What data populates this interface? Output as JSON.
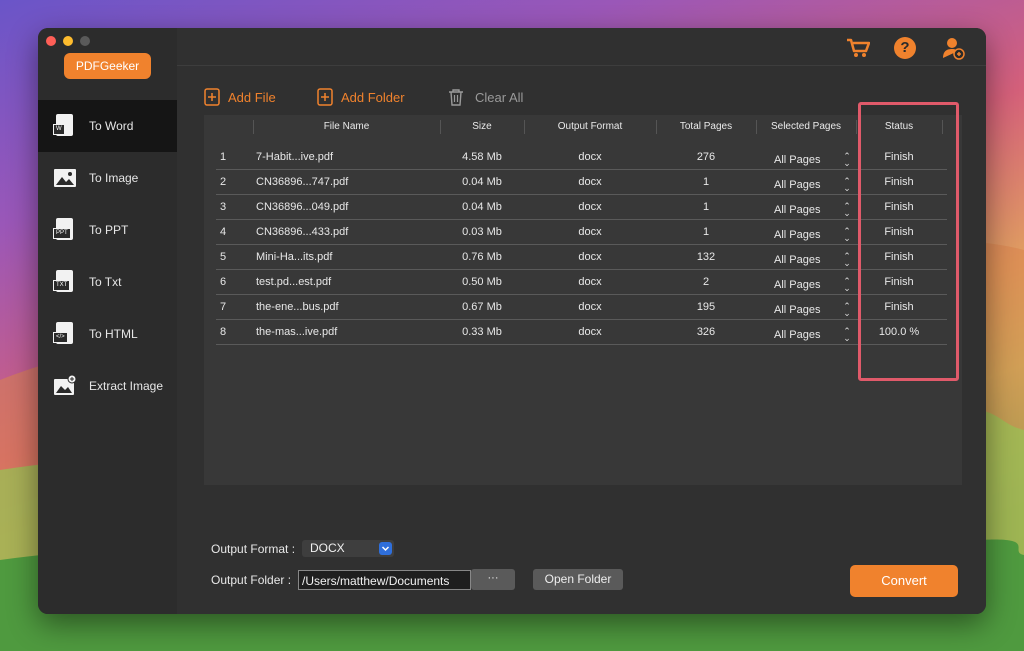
{
  "app": {
    "logo_label": "PDFGeeker"
  },
  "sidebar": {
    "items": [
      {
        "label": "To Word",
        "icon": "word-doc-icon",
        "tag": "W"
      },
      {
        "label": "To Image",
        "icon": "image-icon",
        "tag": ""
      },
      {
        "label": "To PPT",
        "icon": "ppt-doc-icon",
        "tag": "PPT"
      },
      {
        "label": "To Txt",
        "icon": "txt-doc-icon",
        "tag": "TXT"
      },
      {
        "label": "To HTML",
        "icon": "html-doc-icon",
        "tag": "</>"
      },
      {
        "label": "Extract Image",
        "icon": "extract-image-icon",
        "tag": ""
      }
    ]
  },
  "toolbar": {
    "add_file": "Add File",
    "add_folder": "Add Folder",
    "clear_all": "Clear All"
  },
  "table": {
    "headers": [
      "File Name",
      "Size",
      "Output Format",
      "Total Pages",
      "Selected Pages",
      "Status"
    ],
    "rows": [
      {
        "num": "1",
        "name": "7-Habit...ive.pdf",
        "size": "4.58 Mb",
        "format": "docx",
        "pages": "276",
        "selected": "All Pages",
        "status": "Finish"
      },
      {
        "num": "2",
        "name": "CN36896...747.pdf",
        "size": "0.04 Mb",
        "format": "docx",
        "pages": "1",
        "selected": "All Pages",
        "status": "Finish"
      },
      {
        "num": "3",
        "name": "CN36896...049.pdf",
        "size": "0.04 Mb",
        "format": "docx",
        "pages": "1",
        "selected": "All Pages",
        "status": "Finish"
      },
      {
        "num": "4",
        "name": "CN36896...433.pdf",
        "size": "0.03 Mb",
        "format": "docx",
        "pages": "1",
        "selected": "All Pages",
        "status": "Finish"
      },
      {
        "num": "5",
        "name": "Mini-Ha...its.pdf",
        "size": "0.76 Mb",
        "format": "docx",
        "pages": "132",
        "selected": "All Pages",
        "status": "Finish"
      },
      {
        "num": "6",
        "name": "test.pd...est.pdf",
        "size": "0.50 Mb",
        "format": "docx",
        "pages": "2",
        "selected": "All Pages",
        "status": "Finish"
      },
      {
        "num": "7",
        "name": "the-ene...bus.pdf",
        "size": "0.67 Mb",
        "format": "docx",
        "pages": "195",
        "selected": "All Pages",
        "status": "Finish"
      },
      {
        "num": "8",
        "name": "the-mas...ive.pdf",
        "size": "0.33 Mb",
        "format": "docx",
        "pages": "326",
        "selected": "All Pages",
        "status": "100.0 %"
      }
    ]
  },
  "footer": {
    "output_format_label": "Output Format :",
    "output_format_value": "DOCX",
    "output_folder_label": "Output Folder :",
    "output_folder_value": "/Users/matthew/Documents",
    "browse_label": "···",
    "open_folder": "Open Folder",
    "convert": "Convert"
  },
  "colors": {
    "accent": "#f0822d",
    "highlight": "#e05a6a",
    "select_blue": "#2f6fdb"
  }
}
